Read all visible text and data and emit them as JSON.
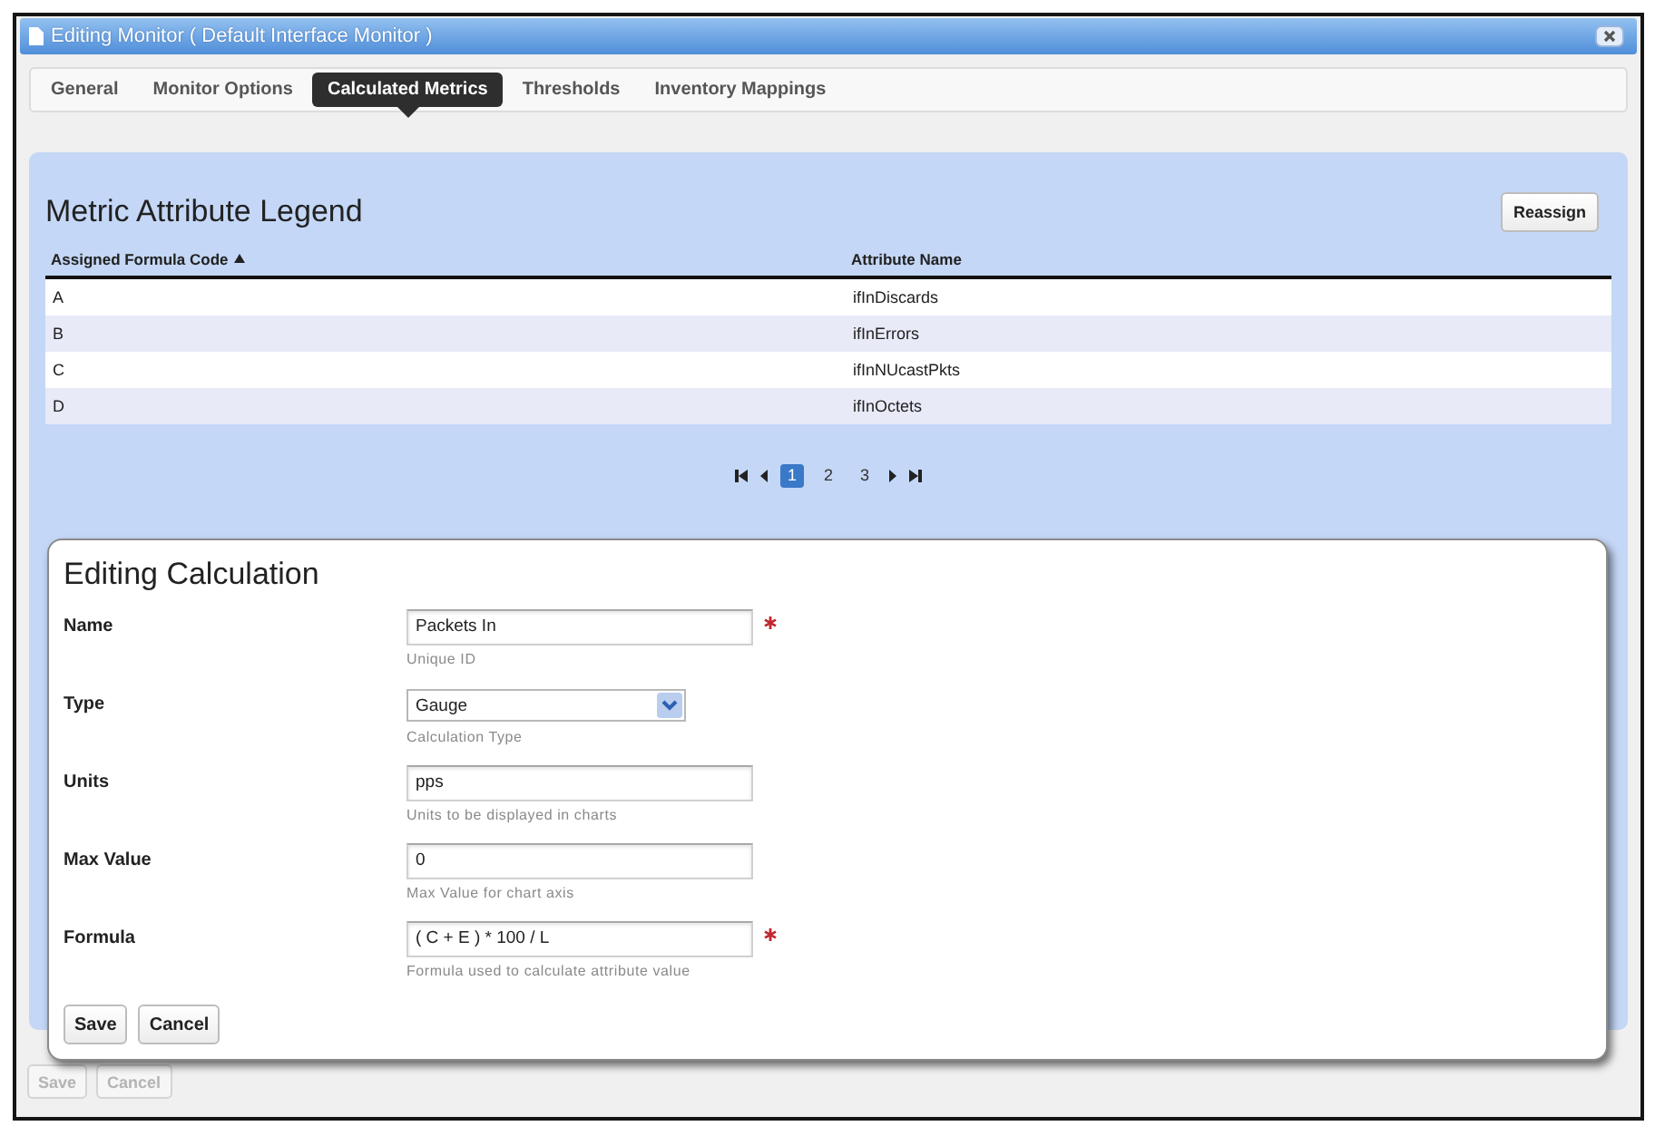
{
  "window": {
    "title": "Editing Monitor ( Default Interface Monitor )"
  },
  "tabs": [
    {
      "label": "General",
      "selected": false
    },
    {
      "label": "Monitor Options",
      "selected": false
    },
    {
      "label": "Calculated Metrics",
      "selected": true
    },
    {
      "label": "Thresholds",
      "selected": false
    },
    {
      "label": "Inventory Mappings",
      "selected": false
    }
  ],
  "legend": {
    "title": "Metric Attribute Legend",
    "reassign_button": "Reassign",
    "table": {
      "columns": [
        {
          "label": "Assigned Formula Code",
          "sorted": true
        },
        {
          "label": "Attribute Name",
          "sorted": false
        }
      ],
      "rows": [
        [
          "A",
          "ifInDiscards"
        ],
        [
          "B",
          "ifInErrors"
        ],
        [
          "C",
          "ifInNUcastPkts"
        ],
        [
          "D",
          "ifInOctets"
        ]
      ]
    },
    "pagination": {
      "pages": [
        {
          "label": "1",
          "selected": true
        },
        {
          "label": "2",
          "selected": false
        },
        {
          "label": "3",
          "selected": false
        }
      ]
    }
  },
  "dialog": {
    "title": "Editing Calculation",
    "fields": [
      {
        "kind": "text",
        "label": "Name",
        "value": "Packets In",
        "hint": "Unique ID",
        "required": true
      },
      {
        "kind": "select",
        "label": "Type",
        "value": "Gauge",
        "hint": "Calculation Type",
        "required": false
      },
      {
        "kind": "text",
        "label": "Units",
        "value": "pps",
        "hint": "Units to be displayed in charts",
        "required": false
      },
      {
        "kind": "text",
        "label": "Max Value",
        "value": "0",
        "hint": "Max Value for chart axis",
        "required": false
      },
      {
        "kind": "text",
        "label": "Formula",
        "value": "( C + E ) * 100 / L",
        "hint": "Formula used to calculate attribute value",
        "required": true
      }
    ],
    "buttons": [
      "Save",
      "Cancel"
    ]
  },
  "footer": {
    "buttons": [
      {
        "label": "Save",
        "disabled": true
      },
      {
        "label": "Cancel",
        "disabled": true
      }
    ]
  }
}
